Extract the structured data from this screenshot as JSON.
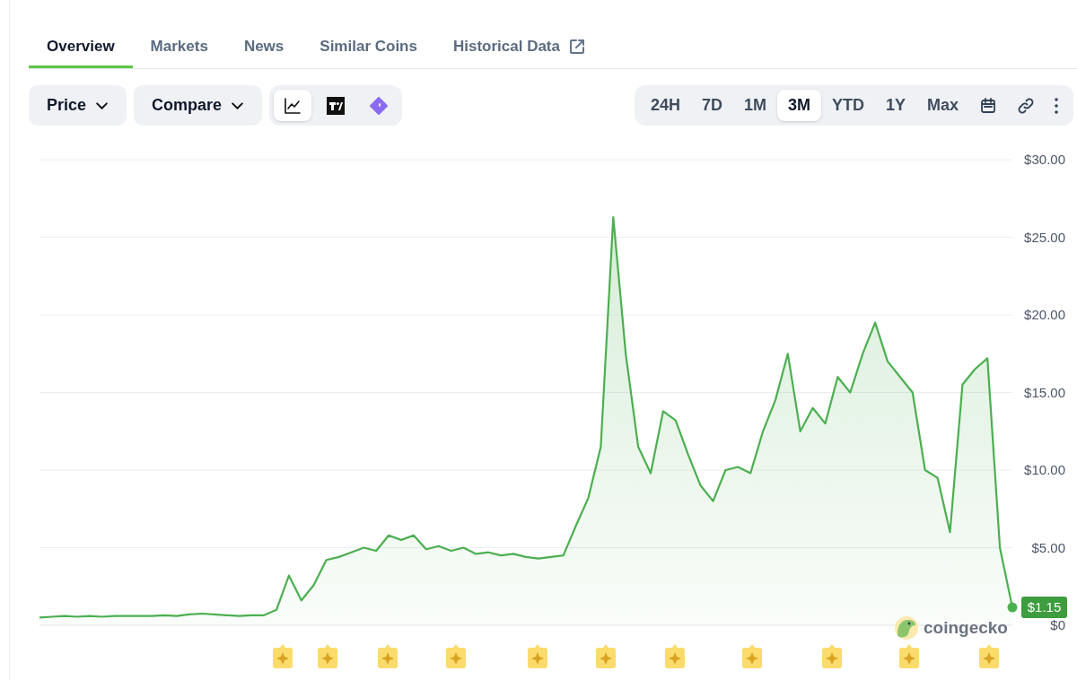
{
  "tabs": [
    {
      "label": "Overview",
      "selected": true
    },
    {
      "label": "Markets",
      "selected": false
    },
    {
      "label": "News",
      "selected": false
    },
    {
      "label": "Similar Coins",
      "selected": false
    },
    {
      "label": "Historical Data",
      "selected": false,
      "external": true
    }
  ],
  "dropdowns": [
    {
      "label": "Price"
    },
    {
      "label": "Compare"
    }
  ],
  "chart_types": [
    {
      "kind": "line",
      "selected": true
    },
    {
      "kind": "tradingview",
      "selected": false
    },
    {
      "kind": "ai",
      "selected": false
    }
  ],
  "ranges": [
    {
      "label": "24H",
      "selected": false
    },
    {
      "label": "7D",
      "selected": false
    },
    {
      "label": "1M",
      "selected": false
    },
    {
      "label": "3M",
      "selected": true
    },
    {
      "label": "YTD",
      "selected": false
    },
    {
      "label": "1Y",
      "selected": false
    },
    {
      "label": "Max",
      "selected": false
    }
  ],
  "chart": {
    "brand": "coingecko",
    "current_price": "$1.15",
    "chart_data": {
      "type": "area",
      "grid": true,
      "ylim": [
        0,
        30
      ],
      "yticks": [
        {
          "value": 0,
          "label": "$0"
        },
        {
          "value": 5,
          "label": "$5.00"
        },
        {
          "value": 10,
          "label": "$10.00"
        },
        {
          "value": 15,
          "label": "$15.00"
        },
        {
          "value": 20,
          "label": "$20.00"
        },
        {
          "value": 25,
          "label": "$25.00"
        },
        {
          "value": 30,
          "label": "$30.00"
        }
      ],
      "series": [
        {
          "color": "#4caf50",
          "values": [
            0.5,
            0.55,
            0.6,
            0.55,
            0.6,
            0.55,
            0.6,
            0.6,
            0.6,
            0.6,
            0.65,
            0.6,
            0.7,
            0.75,
            0.7,
            0.65,
            0.6,
            0.65,
            0.65,
            1.0,
            3.2,
            1.6,
            2.6,
            4.2,
            4.4,
            4.7,
            5.0,
            4.8,
            5.8,
            5.5,
            5.8,
            4.9,
            5.1,
            4.8,
            5.0,
            4.6,
            4.7,
            4.5,
            4.6,
            4.4,
            4.3,
            4.4,
            4.5,
            6.4,
            8.2,
            11.5,
            26.3,
            17.5,
            11.5,
            9.8,
            13.8,
            13.2,
            11,
            9,
            8,
            10,
            10.2,
            9.8,
            12.5,
            14.5,
            17.5,
            12.5,
            14,
            13,
            16,
            15,
            17.5,
            19.5,
            17,
            16,
            15,
            10,
            9.5,
            6,
            15.5,
            16.5,
            17.2,
            5,
            1.15
          ]
        }
      ]
    }
  }
}
